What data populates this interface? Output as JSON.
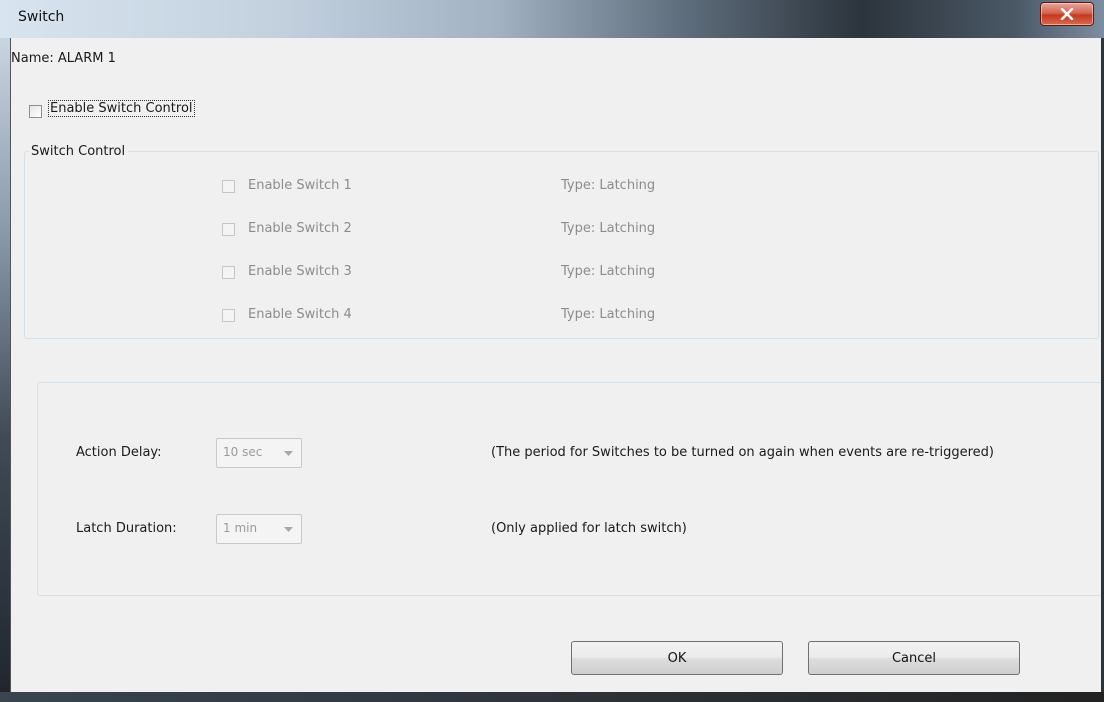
{
  "window": {
    "title": "Switch"
  },
  "header": {
    "name_label": "Name: ALARM  1"
  },
  "enable_control": {
    "label": "Enable Switch Control",
    "checked": false
  },
  "switch_group": {
    "title": "Switch Control",
    "switches": [
      {
        "label": "Enable Switch 1",
        "type": "Type: Latching",
        "checked": false,
        "enabled": false
      },
      {
        "label": "Enable Switch 2",
        "type": "Type: Latching",
        "checked": false,
        "enabled": false
      },
      {
        "label": "Enable Switch 3",
        "type": "Type: Latching",
        "checked": false,
        "enabled": false
      },
      {
        "label": "Enable Switch 4",
        "type": "Type: Latching",
        "checked": false,
        "enabled": false
      }
    ]
  },
  "settings": {
    "action_delay": {
      "label": "Action Delay:",
      "value": "10 sec",
      "hint": "(The period for Switches to be turned on again when events are re-triggered)"
    },
    "latch_duration": {
      "label": "Latch Duration:",
      "value": "1 min",
      "hint": "(Only applied for latch switch)"
    }
  },
  "buttons": {
    "ok": "OK",
    "cancel": "Cancel"
  },
  "icons": {
    "close": "close-icon",
    "dropdown": "chevron-down-icon"
  },
  "colors": {
    "close_button": "#c43a20",
    "dialog_background": "#f0f0f0",
    "disabled_text": "#8c8c8c"
  }
}
